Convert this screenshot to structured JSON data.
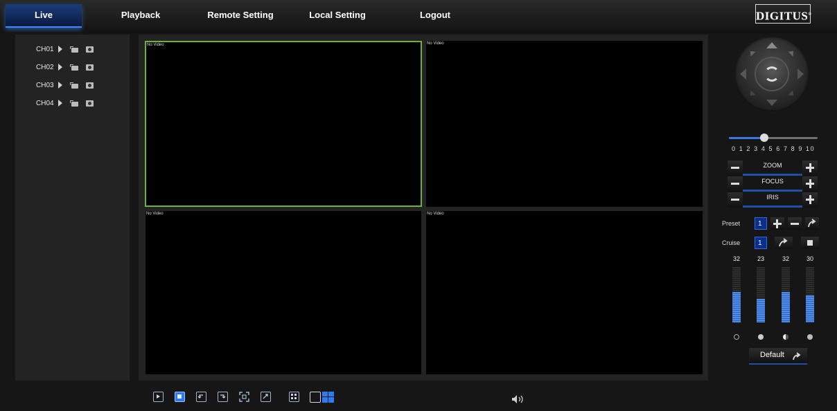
{
  "nav": {
    "tabs": [
      "Live",
      "Playback",
      "Remote Setting",
      "Local Setting",
      "Logout"
    ],
    "active": "Live"
  },
  "brand": {
    "logo": "DIGITUS"
  },
  "channels": [
    {
      "label": "CH01"
    },
    {
      "label": "CH02"
    },
    {
      "label": "CH03"
    },
    {
      "label": "CH04"
    }
  ],
  "video": {
    "cells": [
      {
        "status": "No Video",
        "selected": true
      },
      {
        "status": "No Video",
        "selected": false
      },
      {
        "status": "No Video",
        "selected": false
      },
      {
        "status": "No Video",
        "selected": false
      }
    ]
  },
  "toolbar": {
    "buttons": [
      "play-all-icon",
      "stop-all-icon",
      "previous-screen-icon",
      "next-screen-icon",
      "fullscreen-icon",
      "original-proportion-icon",
      "grid-layout-icon",
      "single-view-icon",
      "quad-view-icon"
    ],
    "volume_icon": "speaker-icon",
    "active_button": "stop-all-icon"
  },
  "ptz": {
    "speed_ticks": "0 1 2 3 4 5 6 7 8 9 10",
    "speed_value": 4,
    "speed_max": 10,
    "lens": [
      {
        "label": "ZOOM"
      },
      {
        "label": "FOCUS"
      },
      {
        "label": "IRIS"
      }
    ],
    "preset_label": "Preset",
    "preset_value": "1",
    "cruise_label": "Cruise",
    "cruise_value": "1"
  },
  "image_adjust": {
    "values": [
      "32",
      "23",
      "32",
      "30"
    ],
    "levels": [
      0.55,
      0.42,
      0.55,
      0.49
    ],
    "icons": [
      "brightness-icon",
      "sharpness-icon",
      "contrast-icon",
      "saturation-icon"
    ],
    "default_label": "Default"
  },
  "colors": {
    "accent": "#3a78e0",
    "selected_border": "#6fb43a",
    "active_tab": "#1b3d7a"
  }
}
